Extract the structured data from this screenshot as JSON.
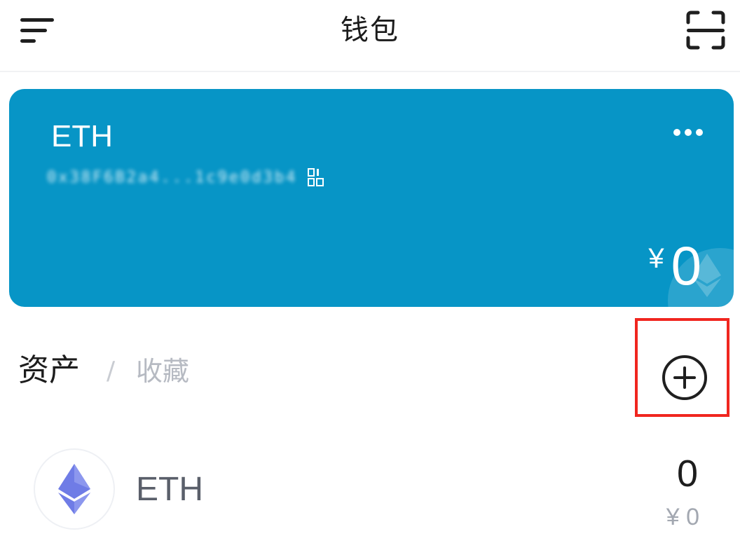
{
  "header": {
    "title": "钱包",
    "menu_icon": "menu-icon",
    "scan_icon": "scan-icon"
  },
  "wallet_card": {
    "name": "ETH",
    "address": "0x38F6B2a4...1c9e0d3b4",
    "currency_symbol": "¥",
    "balance": "0",
    "background_color": "#0795c6",
    "more_icon": "more-dots-icon",
    "qr_icon": "qr-code-icon"
  },
  "assets": {
    "tab_assets": "资产",
    "divider": "/",
    "tab_favorites": "收藏",
    "add_icon": "plus-circle-icon",
    "items": [
      {
        "name": "ETH",
        "amount": "0",
        "fiat_value": "¥ 0",
        "icon": "ethereum-icon",
        "icon_color": "#6f7ce6"
      }
    ]
  },
  "highlight_color": "#f0261f"
}
